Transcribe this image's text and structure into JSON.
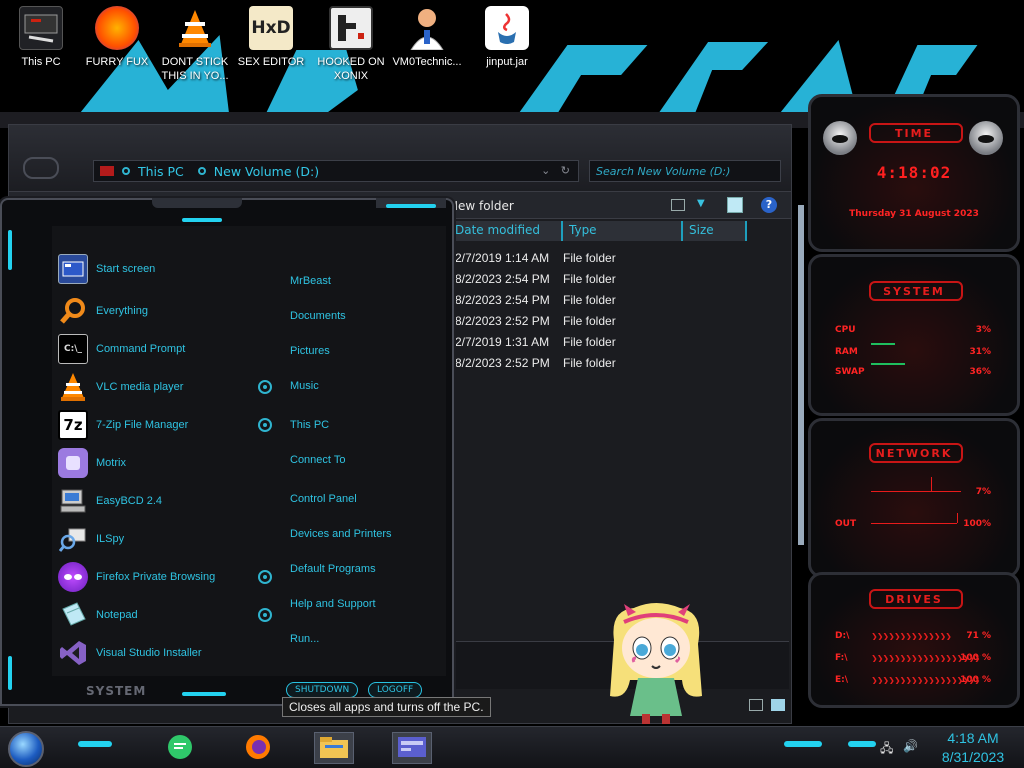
{
  "desktop": {
    "icons": [
      {
        "label": "This PC",
        "icon": "computer-icon"
      },
      {
        "label": "FURRY FUX",
        "icon": "firefox-icon"
      },
      {
        "label": "DONT STICK THIS IN YO...",
        "icon": "vlc-cone-icon"
      },
      {
        "label": "SEX EDITOR",
        "icon": "hxd-editor-icon"
      },
      {
        "label": "HOOKED ON XONIX",
        "icon": "game-icon"
      },
      {
        "label": "VM0Technic...",
        "icon": "doctor-icon"
      },
      {
        "label": "jinput.jar",
        "icon": "java-icon"
      }
    ]
  },
  "explorer": {
    "breadcrumb": [
      "This PC",
      "New Volume (D:)"
    ],
    "search_placeholder": "Search New Volume (D:)",
    "toolbar_new_folder": "New folder",
    "columns": [
      "Date modified",
      "Type",
      "Size"
    ],
    "files": [
      {
        "date": "2/7/2019 1:14 AM",
        "type": "File folder"
      },
      {
        "date": "8/2/2023 2:54 PM",
        "type": "File folder"
      },
      {
        "date": "8/2/2023 2:54 PM",
        "type": "File folder"
      },
      {
        "date": "8/2/2023 2:52 PM",
        "type": "File folder"
      },
      {
        "date": "2/7/2019 1:31 AM",
        "type": "File folder"
      },
      {
        "date": "8/2/2023 2:52 PM",
        "type": "File folder"
      }
    ]
  },
  "start_menu": {
    "programs": [
      {
        "label": "Start screen",
        "icon": "start-screen-icon",
        "jump": false
      },
      {
        "label": "Everything",
        "icon": "magnifier-icon",
        "jump": false
      },
      {
        "label": "Command Prompt",
        "icon": "terminal-icon",
        "jump": false
      },
      {
        "label": "VLC media player",
        "icon": "vlc-cone-icon",
        "jump": true
      },
      {
        "label": "7-Zip File Manager",
        "icon": "7zip-icon",
        "jump": true
      },
      {
        "label": "Motrix",
        "icon": "motrix-icon",
        "jump": false
      },
      {
        "label": "EasyBCD 2.4",
        "icon": "easybcd-icon",
        "jump": false
      },
      {
        "label": "ILSpy",
        "icon": "ilspy-icon",
        "jump": false
      },
      {
        "label": "Firefox Private Browsing",
        "icon": "private-browsing-icon",
        "jump": true
      },
      {
        "label": "Notepad",
        "icon": "notepad-icon",
        "jump": true
      },
      {
        "label": "Visual Studio Installer",
        "icon": "visual-studio-icon",
        "jump": false
      }
    ],
    "places": [
      "MrBeast",
      "Documents",
      "Pictures",
      "Music",
      "This PC",
      "Connect To",
      "Control Panel",
      "Devices and Printers",
      "Default Programs",
      "Help and Support",
      "Run..."
    ],
    "system_label": "SYSTEM",
    "shutdown_label": "SHUTDOWN",
    "logoff_label": "LOGOFF",
    "tooltip": "Closes all apps and turns off the PC."
  },
  "gadgets": {
    "time_title": "TIME",
    "time_value": "4:18:02",
    "date_value": "Thursday 31 August 2023",
    "system_title": "SYSTEM",
    "system_rows": [
      {
        "label": "CPU",
        "value": "3%"
      },
      {
        "label": "RAM",
        "value": "31%"
      },
      {
        "label": "SWAP",
        "value": "36%"
      }
    ],
    "network_title": "NETWORK",
    "network_rows": [
      {
        "label": "",
        "value": "7%"
      },
      {
        "label": "OUT",
        "value": "100%"
      }
    ],
    "drives_title": "DRIVES",
    "drives": [
      {
        "label": "D:\\",
        "value": "71 %"
      },
      {
        "label": "F:\\",
        "value": "100 %"
      },
      {
        "label": "E:\\",
        "value": "100 %"
      }
    ]
  },
  "taskbar": {
    "time": "4:18 AM",
    "date": "8/31/2023"
  },
  "colors": {
    "accent": "#23d2f0",
    "gadget_red": "#e61d1d"
  }
}
